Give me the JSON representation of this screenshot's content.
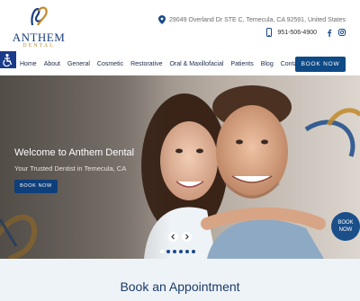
{
  "brand": {
    "name": "ANTHEM",
    "sub": "DENTAL",
    "colors": {
      "navy": "#1a3d7c",
      "gold": "#c28a2a",
      "button": "#0e4a86"
    }
  },
  "contact": {
    "address": "29049 Overland Dr STE C, Temecula, CA 92591, United States",
    "phone": "951-506-4900",
    "icons": [
      "map-pin-icon",
      "phone-icon",
      "facebook-icon",
      "instagram-icon"
    ]
  },
  "nav": {
    "items": [
      "Home",
      "About",
      "General",
      "Cosmetic",
      "Restorative",
      "Oral & Maxillofacial",
      "Patients",
      "Blog",
      "Contact Us"
    ],
    "book_label": "BOOK NOW"
  },
  "hero": {
    "title": "Welcome to Anthem Dental",
    "subtitle": "Your Trusted Dentist in Temecula, CA",
    "button_label": "BOOK NOW",
    "prev_icon": "chevron-left-icon",
    "next_icon": "chevron-right-icon",
    "slide_count": 6,
    "active_slide": 1
  },
  "floating": {
    "line1": "BOOK",
    "line2": "NOW"
  },
  "appointment": {
    "title": "Book an Appointment"
  }
}
